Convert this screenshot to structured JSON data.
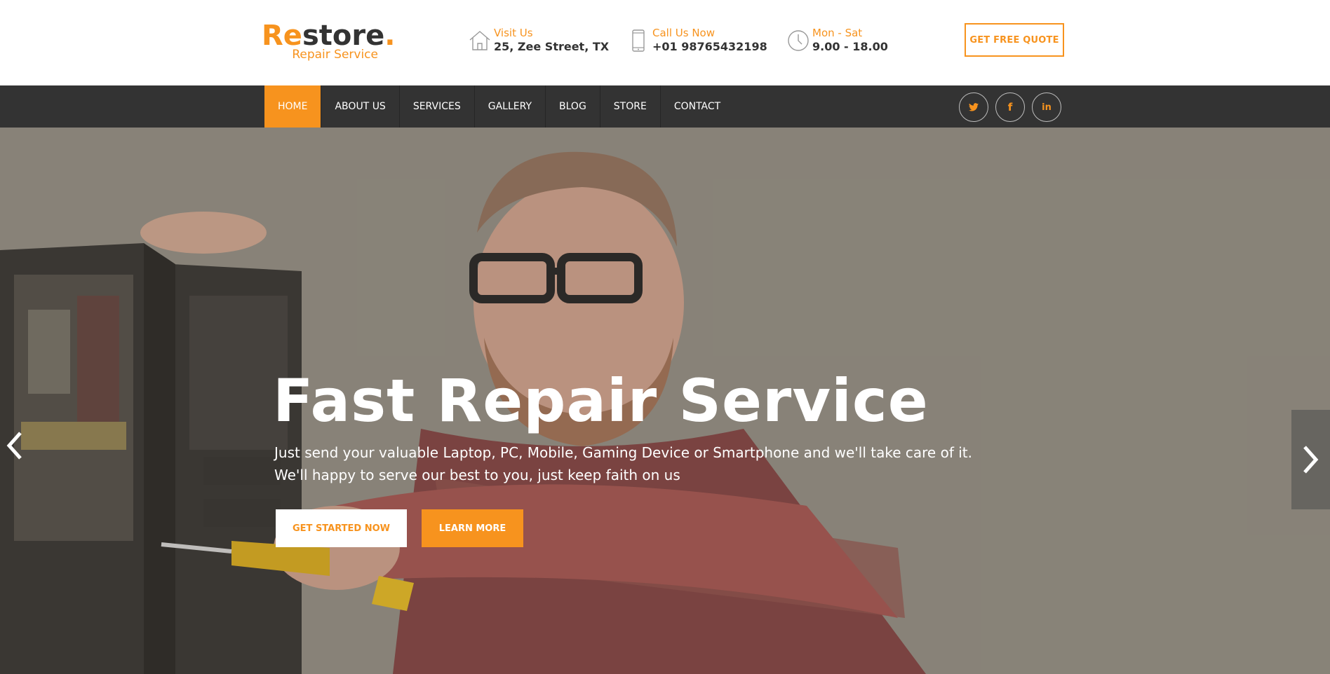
{
  "logo": {
    "accent_part": "Re",
    "dark_part": "store",
    "dot": ".",
    "tagline": "Repair Service"
  },
  "contact": {
    "visit": {
      "label": "Visit Us",
      "value": "25, Zee Street, TX",
      "icon": "house-icon"
    },
    "call": {
      "label": "Call Us Now",
      "value": "+01 98765432198",
      "icon": "mobile-phone-icon"
    },
    "hours": {
      "label": "Mon - Sat",
      "value": "9.00 - 18.00",
      "icon": "clock-icon"
    }
  },
  "header": {
    "quote_button": "GET FREE QUOTE"
  },
  "nav": {
    "items": [
      "HOME",
      "ABOUT US",
      "SERVICES",
      "GALLERY",
      "BLOG",
      "STORE",
      "CONTACT"
    ],
    "active": "HOME"
  },
  "social": [
    "twitter-icon",
    "facebook-icon",
    "linkedin-icon"
  ],
  "hero": {
    "title": "Fast Repair Service",
    "line1": "Just send your valuable Laptop, PC, Mobile, Gaming Device or Smartphone and we'll take care of it.",
    "line2": "We'll happy to serve our best to you, just keep faith on us",
    "primary_button": "GET STARTED NOW",
    "secondary_button": "LEARN MORE"
  },
  "colors": {
    "accent": "#f7931e",
    "nav_bg": "#333333",
    "text_dark": "#333333",
    "hero_bg": "#8b877d"
  }
}
